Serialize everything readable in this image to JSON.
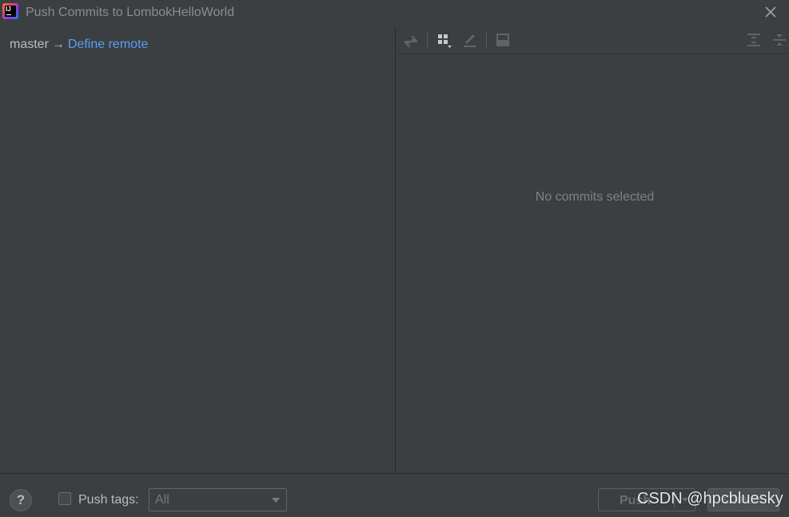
{
  "window": {
    "title": "Push Commits to LombokHelloWorld",
    "app_icon": "intellij-idea-icon",
    "close_icon": "close-icon"
  },
  "branch": {
    "local": "master",
    "arrow": "→",
    "remote_link": "Define remote"
  },
  "toolbar": {
    "icons": [
      "show-diff-icon",
      "group-by-icon",
      "edit-source-icon",
      "preview-diff-icon",
      "expand-all-icon",
      "collapse-all-icon"
    ]
  },
  "details": {
    "empty_text": "No commits selected"
  },
  "footer": {
    "help_label": "?",
    "push_tags_label": "Push tags:",
    "push_tags_checked": false,
    "tags_select_value": "All",
    "push_button": "Push",
    "cancel_button": "Cancel"
  },
  "watermark": "CSDN @hpcbluesky",
  "colors": {
    "background": "#3c3f41",
    "link": "#589df6",
    "text": "#bbbbbb",
    "muted_text": "#808080"
  }
}
